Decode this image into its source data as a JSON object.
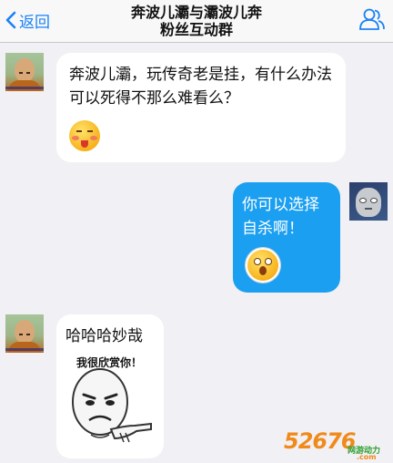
{
  "navbar": {
    "back_label": "返回",
    "title_line1": "奔波儿灞与灞波儿奔",
    "title_line2": "粉丝互动群",
    "group_icon": "group-members-icon"
  },
  "messages": [
    {
      "direction": "incoming",
      "text": "奔波儿灞，玩传奇老是挂，有什么办法可以死得不那么难看么？",
      "emoji": "tongue-out-emoji"
    },
    {
      "direction": "outgoing",
      "text": "你可以选择自杀啊！",
      "emoji": "shocked-emoji"
    },
    {
      "direction": "incoming",
      "text": "哈哈哈妙哉",
      "sticker_caption": "我很欣赏你！"
    }
  ],
  "watermark": {
    "digits": "52676",
    "sub": "网游动力",
    "domain": ".com"
  },
  "colors": {
    "accent": "#1a82f5",
    "outgoing_bubble": "#1b9ff0",
    "background": "#f1f0f4"
  }
}
